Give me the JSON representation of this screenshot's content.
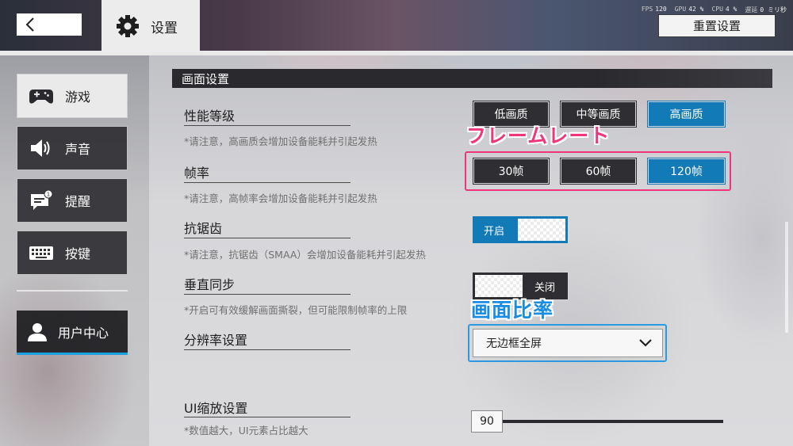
{
  "header": {
    "title": "设置",
    "reset_label": "重置设置",
    "perf": {
      "fps_label": "FPS",
      "fps_value": "120",
      "gpu_label": "GPU",
      "gpu_value": "42 %",
      "cpu_label": "CPU",
      "cpu_value": "4 %",
      "latency_label": "遅延",
      "latency_value": "0 ミリ秒"
    }
  },
  "sidebar": {
    "items": [
      {
        "label": "游戏",
        "icon": "gamepad-icon",
        "active": true
      },
      {
        "label": "声音",
        "icon": "speaker-icon",
        "active": false
      },
      {
        "label": "提醒",
        "icon": "notification-icon",
        "active": false
      },
      {
        "label": "按键",
        "icon": "keyboard-icon",
        "active": false
      }
    ],
    "user_center": {
      "label": "用户中心",
      "icon": "user-icon"
    }
  },
  "main": {
    "section_title": "画面设置",
    "quality": {
      "title": "性能等级",
      "note": "*请注意，高画质会增加设备能耗并引起发热",
      "options": [
        "低画质",
        "中等画质",
        "高画质"
      ],
      "selected": "高画质"
    },
    "framerate": {
      "title": "帧率",
      "note": "*请注意，高帧率会增加设备能耗并引起发热",
      "options": [
        "30帧",
        "60帧",
        "120帧"
      ],
      "selected": "120帧"
    },
    "antialias": {
      "title": "抗锯齿",
      "note": "*请注意，抗锯齿（SMAA）会增加设备能耗并引起发热",
      "state_label": "开启",
      "on": true
    },
    "vsync": {
      "title": "垂直同步",
      "note": "*开启可有效缓解画面撕裂，但可能限制帧率的上限",
      "state_label": "关闭",
      "on": false
    },
    "resolution": {
      "title": "分辨率设置",
      "selected": "无边框全屏"
    },
    "ui_scale": {
      "title": "UI缩放设置",
      "note": "*数值越大，UI元素占比越大",
      "value": "90"
    }
  },
  "annotations": {
    "framerate_label": "フレームレート",
    "aspect_label": "画面比率",
    "framerate_color": "#f0357d",
    "aspect_color": "#1a8de0"
  },
  "colors": {
    "accent": "#137ab8",
    "dark": "#2f2f33"
  }
}
